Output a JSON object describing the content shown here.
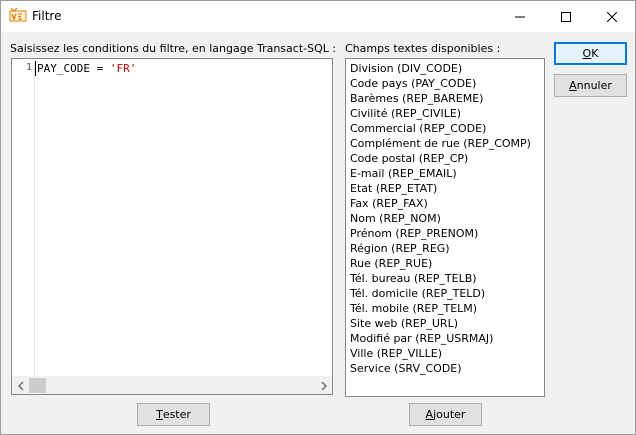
{
  "window": {
    "title": "Filtre",
    "app_icon": "vega-app-icon",
    "controls": {
      "minimize": "minimize-icon",
      "maximize": "maximize-icon",
      "close": "close-icon"
    }
  },
  "editor": {
    "label": "Saisissez les conditions du filtre, en langage Transact-SQL :",
    "line_number": "1",
    "code_prefix": "PAY_CODE = ",
    "code_string": "'FR'"
  },
  "fields": {
    "label": "Champs textes disponibles :",
    "items": [
      "Division (DIV_CODE)",
      "Code pays (PAY_CODE)",
      "Barèmes (REP_BAREME)",
      "Civilité (REP_CIVILE)",
      "Commercial (REP_CODE)",
      "Complément de rue (REP_COMP)",
      "Code postal (REP_CP)",
      "E-mail (REP_EMAIL)",
      "Etat (REP_ETAT)",
      "Fax (REP_FAX)",
      "Nom (REP_NOM)",
      "Prénom (REP_PRENOM)",
      "Région (REP_REG)",
      "Rue (REP_RUE)",
      "Tél. bureau (REP_TELB)",
      "Tél. domicile (REP_TELD)",
      "Tél. mobile (REP_TELM)",
      "Site web (REP_URL)",
      "Modifié par (REP_USRMAJ)",
      "Ville (REP_VILLE)",
      "Service (SRV_CODE)"
    ]
  },
  "buttons": {
    "ok": {
      "mnemonic": "O",
      "rest": "K"
    },
    "cancel": {
      "mnemonic": "A",
      "rest": "nnuler"
    },
    "test": {
      "mnemonic": "T",
      "rest": "ester"
    },
    "add": {
      "mnemonic": "A",
      "rest": "jouter"
    }
  }
}
